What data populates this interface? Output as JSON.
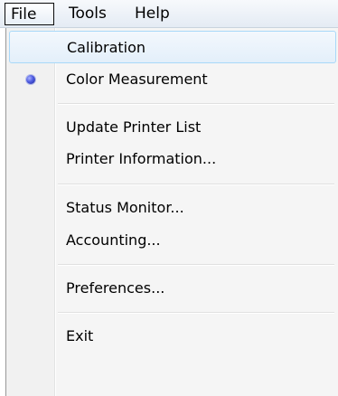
{
  "menubar": {
    "items": [
      {
        "label": "File"
      },
      {
        "label": "Tools"
      },
      {
        "label": "Help"
      }
    ]
  },
  "file_menu": {
    "items": [
      {
        "label": "Calibration",
        "state": "hover"
      },
      {
        "label": "Color Measurement",
        "checked": true
      },
      {
        "label": "Update Printer List"
      },
      {
        "label": "Printer Information..."
      },
      {
        "label": "Status Monitor..."
      },
      {
        "label": "Accounting..."
      },
      {
        "label": "Preferences..."
      },
      {
        "label": "Exit"
      }
    ]
  },
  "colors": {
    "hover_border": "#a8d8f8",
    "radio_bullet": "#4d5ae0"
  }
}
